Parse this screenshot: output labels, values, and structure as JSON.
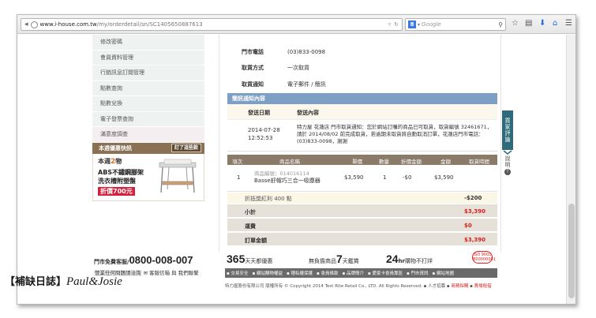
{
  "browser": {
    "url_domain": "www.i-house.com.tw",
    "url_path": "/my/orderdetail/sn/SC1405650887613",
    "search_placeholder": "Google",
    "search_engine_badge": "8"
  },
  "sidebar": {
    "items": [
      {
        "label": "修改密碼"
      },
      {
        "label": "會員資料管理"
      },
      {
        "label": "行銷訊息訂閱管理"
      },
      {
        "label": "點數查詢"
      },
      {
        "label": "點數兌換"
      },
      {
        "label": "電子發票查詢"
      },
      {
        "label": "滿意度調查"
      }
    ],
    "promo": {
      "title": "本週優惠快訊",
      "more_label": "訂了這些款",
      "line1_prefix": "本週",
      "line1_number": "2",
      "line1_suffix": "物",
      "line2": "ABS不鏽鋼腳架",
      "line3": "洗衣槽附塑盤",
      "price": "折價700元"
    }
  },
  "order": {
    "store_phone_label": "門市電話",
    "store_phone_value": "(03)833-0098",
    "pickup_method_label": "取貨方式",
    "pickup_method_value": "一次取貨",
    "pickup_notice_label": "取貨通知",
    "pickup_notice_value": "電子郵件 / 簡訊"
  },
  "notice": {
    "section_title": "簡訊通知內容",
    "col_date": "發送日期",
    "col_content": "發送內容",
    "date_line1": "2014-07-28",
    "date_line2": "12:52:53",
    "content": "特力屋 花蓮店 門市取貨通知：您於網站訂購的商品已可取貨，取貨編號 32461671，請於 2014/08/02 前完成取貨，若逾期未取貨將自動取消訂單，花蓮店門市電話：(03)833-0098，謝謝"
  },
  "items": {
    "headers": [
      "項次",
      "商品名稱",
      "單價",
      "數量",
      "折價金額",
      "金額",
      "取貨時間"
    ],
    "rows": [
      {
        "index": "1",
        "code": "商品編號：014016114",
        "name": "Basse舒帽巧三合一吸塵器",
        "price": "$3,590",
        "qty": "1",
        "discount": "-$0",
        "amount": "$3,590",
        "pickup_time": ""
      }
    ]
  },
  "points": {
    "label": "折抵獎紅利 400 點",
    "value": "-$200"
  },
  "summary": [
    {
      "label": "小計",
      "value": "$3,390"
    },
    {
      "label": "運費",
      "value": "$0"
    },
    {
      "label": "訂單金額",
      "value": "$3,390"
    }
  ],
  "floating": {
    "qa_tab_chars": [
      "買",
      "家",
      "評",
      "論"
    ],
    "help_chars": [
      "說",
      "明"
    ],
    "help_icon": "?"
  },
  "footer": {
    "hotline_label": "門市免費客服/",
    "hotline_number": "0800-008-007",
    "hotline_line2_a": "營業任何問題請洽詢",
    "hotline_line2_b": "客服信箱 與 我們聯繫",
    "slogan1_number": "365",
    "slogan1_text": "天天都優惠",
    "slogan2_prefix": "無負擔商品",
    "slogan2_number": "7",
    "slogan2_text": "天鑑賞",
    "slogan3_number": "24",
    "slogan3_unit": "hr",
    "slogan3_text": "購物不打烊",
    "cert_line1": "ISO 9001",
    "cert_line2": "B00000001",
    "nav": [
      "交易安全",
      "網站購物權益",
      "隱私權保護",
      "會員條款",
      "品牌簡介",
      "愛家卡會員專區",
      "門市資訊",
      "網站地圖"
    ],
    "copyright": "特力屋股份有限公司 版權所有 © Copyright 2014 Test Rite Retail Co., LTD. All Rights Reserved.",
    "copyright_links": [
      "人才招募",
      "商務採購",
      "賣場租借"
    ]
  },
  "watermark": {
    "prefix": "【補缺日誌】",
    "signature": "Paul&Josie"
  }
}
